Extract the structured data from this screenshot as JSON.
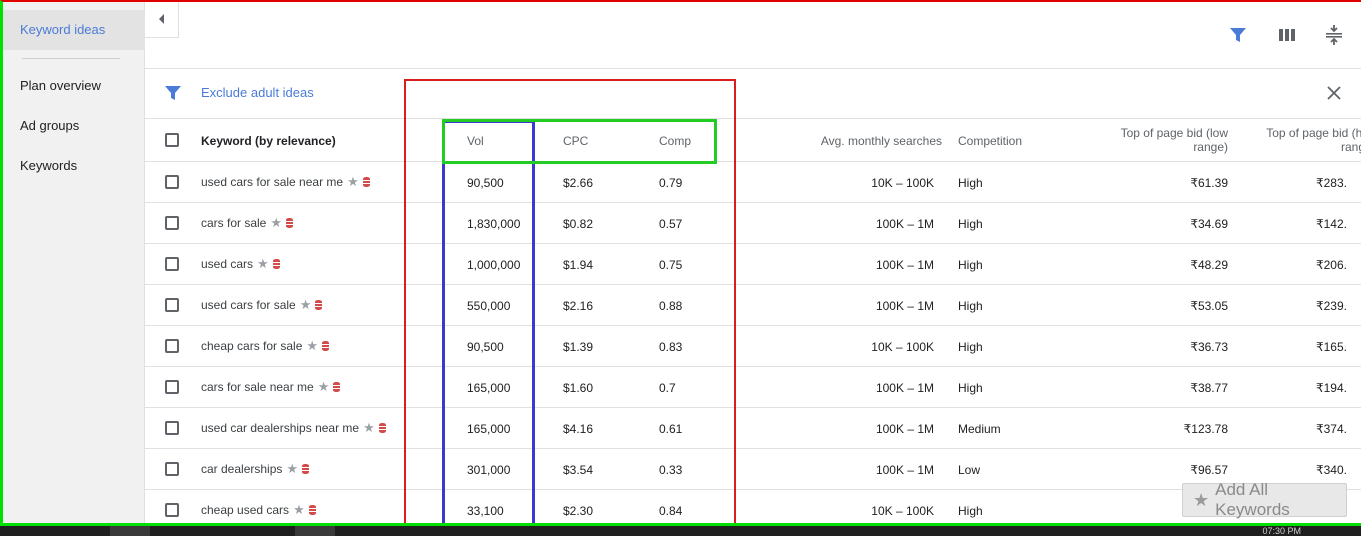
{
  "sidebar": {
    "items": [
      {
        "label": "Keyword ideas",
        "active": true
      },
      {
        "label": "Plan overview",
        "active": false
      },
      {
        "label": "Ad groups",
        "active": false
      },
      {
        "label": "Keywords",
        "active": false
      }
    ]
  },
  "toolbar": {
    "icons": [
      "filter-icon",
      "columns-icon",
      "compact-rows-icon"
    ],
    "accent_color": "#4a7bd6"
  },
  "filter": {
    "label": "Exclude adult ideas"
  },
  "table": {
    "headers": {
      "keyword": "Keyword (by relevance)",
      "vol": "Vol",
      "cpc": "CPC",
      "comp": "Comp",
      "avg_monthly": "Avg. monthly searches",
      "competition": "Competition",
      "top_low": "Top of page bid (low range)",
      "top_high": "Top of page bid (hi rang"
    },
    "rows": [
      {
        "keyword": "used cars for sale near me",
        "vol": "90,500",
        "cpc": "$2.66",
        "comp": "0.79",
        "avg": "10K – 100K",
        "competition": "High",
        "low": "₹61.39",
        "high": "₹283."
      },
      {
        "keyword": "cars for sale",
        "vol": "1,830,000",
        "cpc": "$0.82",
        "comp": "0.57",
        "avg": "100K – 1M",
        "competition": "High",
        "low": "₹34.69",
        "high": "₹142."
      },
      {
        "keyword": "used cars",
        "vol": "1,000,000",
        "cpc": "$1.94",
        "comp": "0.75",
        "avg": "100K – 1M",
        "competition": "High",
        "low": "₹48.29",
        "high": "₹206."
      },
      {
        "keyword": "used cars for sale",
        "vol": "550,000",
        "cpc": "$2.16",
        "comp": "0.88",
        "avg": "100K – 1M",
        "competition": "High",
        "low": "₹53.05",
        "high": "₹239."
      },
      {
        "keyword": "cheap cars for sale",
        "vol": "90,500",
        "cpc": "$1.39",
        "comp": "0.83",
        "avg": "10K – 100K",
        "competition": "High",
        "low": "₹36.73",
        "high": "₹165."
      },
      {
        "keyword": "cars for sale near me",
        "vol": "165,000",
        "cpc": "$1.60",
        "comp": "0.7",
        "avg": "100K – 1M",
        "competition": "High",
        "low": "₹38.77",
        "high": "₹194."
      },
      {
        "keyword": "used car dealerships near me",
        "vol": "165,000",
        "cpc": "$4.16",
        "comp": "0.61",
        "avg": "100K – 1M",
        "competition": "Medium",
        "low": "₹123.78",
        "high": "₹374."
      },
      {
        "keyword": "car dealerships",
        "vol": "301,000",
        "cpc": "$3.54",
        "comp": "0.33",
        "avg": "100K – 1M",
        "competition": "Low",
        "low": "₹96.57",
        "high": "₹340."
      },
      {
        "keyword": "cheap used cars",
        "vol": "33,100",
        "cpc": "$2.30",
        "comp": "0.84",
        "avg": "10K – 100K",
        "competition": "High",
        "low": "",
        "high": ""
      }
    ]
  },
  "add_all": {
    "label": "Add All Keywords"
  },
  "taskbar": {
    "clock": "07:30 PM"
  },
  "annotation_colors": {
    "red": "#d81e1e",
    "blue": "#3a3ad0",
    "green": "#22cc22"
  }
}
